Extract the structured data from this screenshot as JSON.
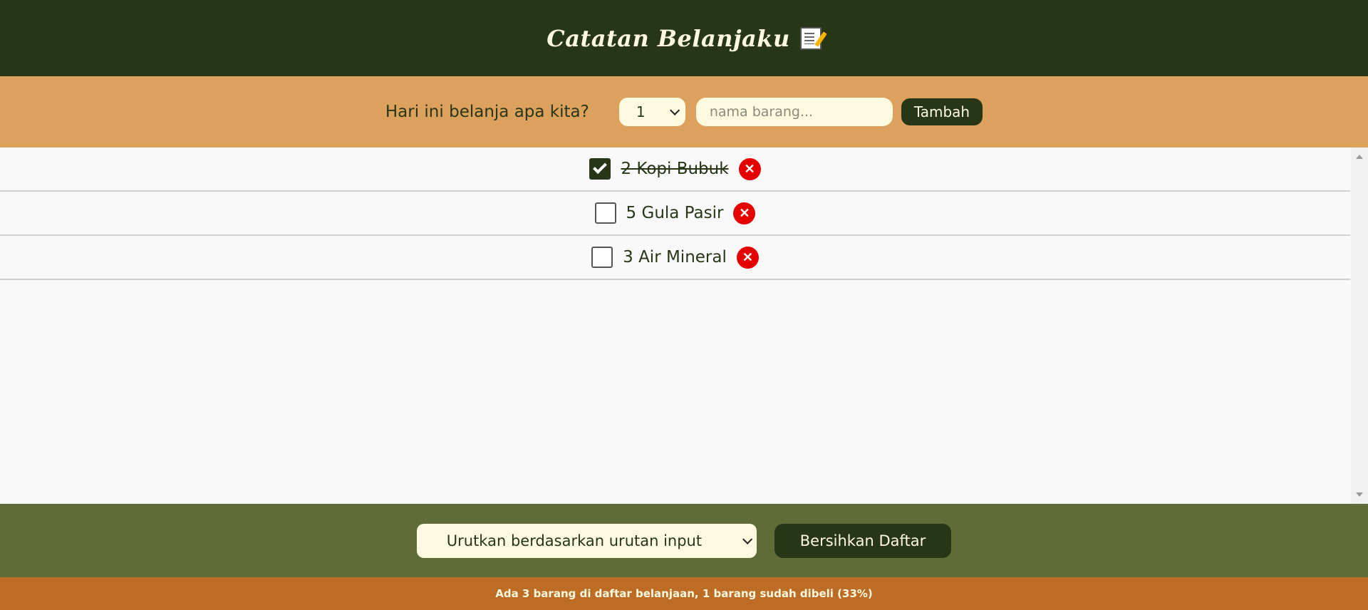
{
  "header": {
    "title": "Catatan Belanjaku",
    "icon": "memo-icon"
  },
  "add_form": {
    "question": "Hari ini belanja apa kita?",
    "quantity_selected": "1",
    "name_placeholder": "nama barang...",
    "name_value": "",
    "add_label": "Tambah"
  },
  "items": [
    {
      "text": "2 Kopi Bubuk",
      "checked": true
    },
    {
      "text": "5 Gula Pasir",
      "checked": false
    },
    {
      "text": "3 Air Mineral",
      "checked": false
    }
  ],
  "actions": {
    "sort_selected": "Urutkan berdasarkan urutan input",
    "clear_label": "Bersihkan Daftar"
  },
  "footer": {
    "stats": "Ada 3 barang di daftar belanjaan, 1 barang sudah dibeli (33%)"
  },
  "colors": {
    "header_bg": "#283618",
    "form_bg": "#dda15e",
    "actions_bg": "#606c38",
    "footer_bg": "#bc6c25",
    "cream": "#fefae0",
    "delete_red": "#e50000"
  }
}
